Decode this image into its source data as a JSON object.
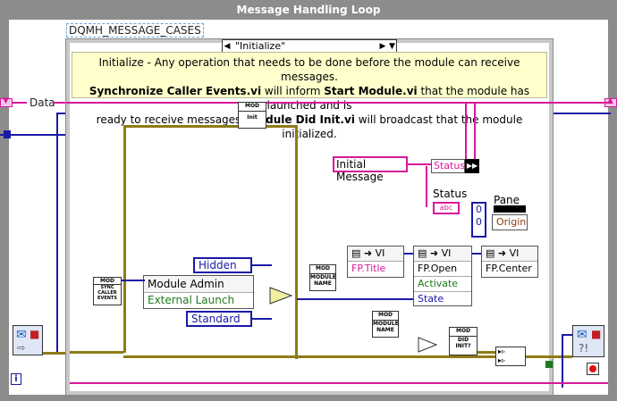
{
  "loop": {
    "title": "Message Handling Loop"
  },
  "case": {
    "cases_label": "DQMH_MESSAGE_CASES",
    "selector_value": "\"Initialize\"",
    "comment_line1": "Initialize - Any operation that needs to be done before the module can receive messages.",
    "comment_line2a": "Synchronize Caller Events.vi",
    "comment_line2b": " will inform ",
    "comment_line2c": "Start Module.vi",
    "comment_line2d": " that the module has launched and is",
    "comment_line3a": "ready to receive messages. ",
    "comment_line3b": "Module Did Init.vi",
    "comment_line3c": " will broadcast that the module initialized."
  },
  "data_label": "Data",
  "terminals": {
    "initial_message": "Initial Message",
    "status_unbundle": "Status",
    "status_label": "Status",
    "pane_label": "Pane",
    "origin": "Origin",
    "hidden": "Hidden",
    "standard": "Standard",
    "module_admin": "Module Admin",
    "external_launch": "External Launch",
    "fp_title": "FP.Title",
    "fp_open": "FP.Open",
    "activate": "Activate",
    "state": "State",
    "fp_center": "FP.Center",
    "vi": "VI",
    "iteration": "i",
    "zero": "0"
  },
  "subvis": {
    "init_top": "MOD",
    "init_bottom": "Init",
    "sync_top": "MOD",
    "sync_bottom": "SYNC CALLER EVENTS",
    "name1_top": "MOD",
    "name1_bottom": "MODULE NAME",
    "name2_top": "MOD",
    "name2_bottom": "MODULE NAME",
    "didinit_top": "MOD",
    "didinit_bottom": "DID INIT?"
  },
  "colors": {
    "string_wire": "#d8199a",
    "enum_wire": "#1a1aa6",
    "cluster_wire": "#8d7b17",
    "loop_border": "#8c8c8c",
    "comment_bg": "#ffffcc"
  }
}
